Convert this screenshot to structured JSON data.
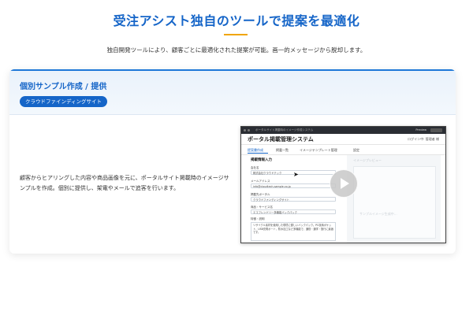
{
  "hero": {
    "title": "受注アシスト独自のツールで提案を最適化",
    "subtitle": "独自開発ツールにより、顧客ごとに最適化された提案が可能。画一的メッセージから脱却します。"
  },
  "card": {
    "title": "個別サンプル作成 / 提供",
    "tag": "クラウドファインディングサイト",
    "description": "顧客からヒアリングした内容や商品画像を元に、ポータルサイト掲載時のイメージサンプルを作成。個別に提供し、架電やメールで追客を行います。"
  },
  "mock": {
    "chrome_title": "ポータルサイト掲載時のイメージ作成システム",
    "chrome_preview": "Preview",
    "app_title": "ポータル掲載管理システム",
    "login_text": "ログイン中: 管理者 様",
    "tabs": [
      "提案書作成",
      "掲載一覧",
      "イメージテンプレート管理",
      "設定"
    ],
    "section_title": "掲載情報入力",
    "fields": [
      {
        "label": "会社名",
        "value": "株式会社クラウドテック"
      },
      {
        "label": "メールアドレス",
        "value": "info@cloudtech-sample.co.jp"
      },
      {
        "label": "掲載先ポータル",
        "value": "クラウドファンディングサイト"
      },
      {
        "label": "商品・サービス名",
        "value": "エコフレンドリー多機能バックパック"
      }
    ],
    "desc_label": "特徴・説明",
    "desc_text": "リサイクル素材を使用した環境に優しいバックパック。PC収納ポケット、USB充電ポート、防水加工など多機能で、通勤・通学・旅行に最適です。",
    "preview_label": "イメージプレビュー",
    "preview_text": "サンプルイメージ生成中…"
  },
  "icons": {
    "play": "play-icon",
    "cursor": "cursor-icon"
  },
  "colors": {
    "brand": "#1565c8",
    "accent": "#f0a500"
  }
}
